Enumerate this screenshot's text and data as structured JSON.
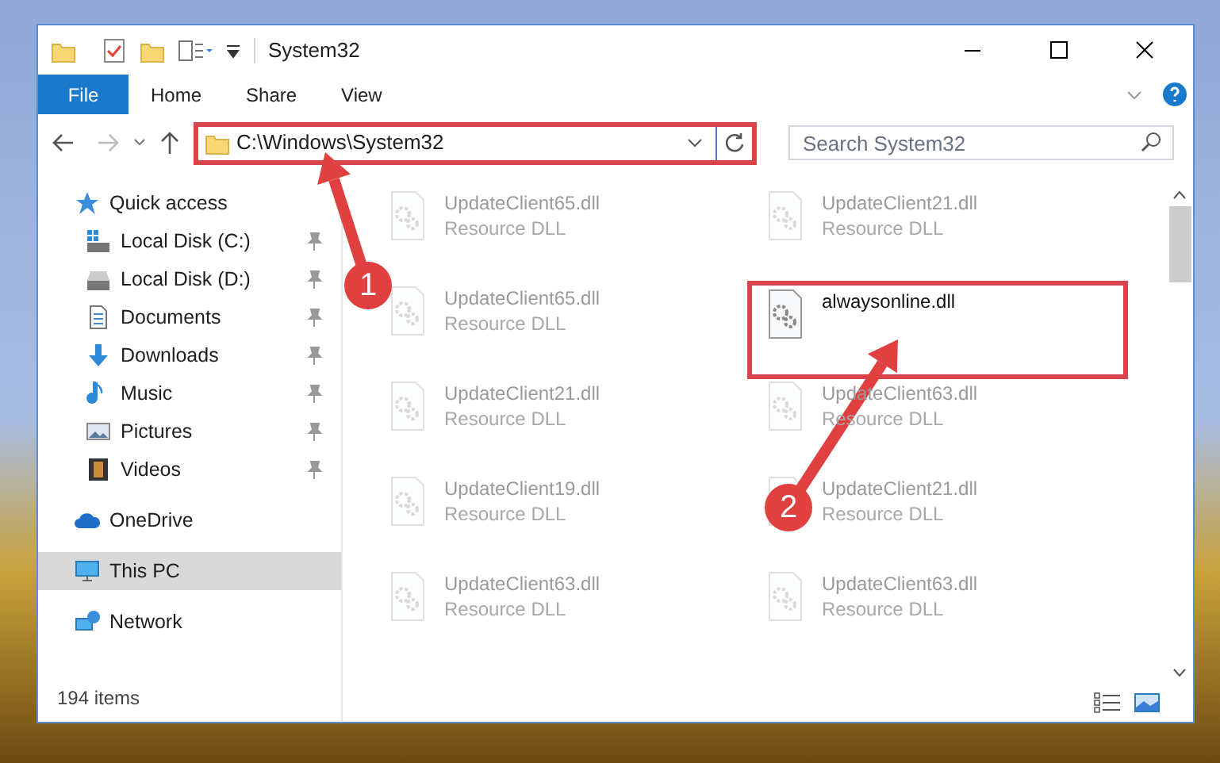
{
  "window": {
    "title": "System32"
  },
  "ribbon_tabs": [
    {
      "label": "File",
      "kind": "file"
    },
    {
      "label": "Home",
      "kind": "tab"
    },
    {
      "label": "Share",
      "kind": "tab"
    },
    {
      "label": "View",
      "kind": "tab"
    }
  ],
  "address_bar": {
    "path": "C:\\Windows\\System32",
    "highlighted": true
  },
  "search": {
    "placeholder": "Search System32"
  },
  "sidebar": {
    "items": [
      {
        "label": "Quick access",
        "selected": false,
        "children": [
          {
            "label": "Local Disk (C:)",
            "pinned": true
          },
          {
            "label": "Local Disk (D:)",
            "pinned": true
          },
          {
            "label": "Documents",
            "pinned": true
          },
          {
            "label": "Downloads",
            "pinned": true
          },
          {
            "label": "Music",
            "pinned": true
          },
          {
            "label": "Pictures",
            "pinned": true
          },
          {
            "label": "Videos",
            "pinned": true
          }
        ]
      },
      {
        "label": "OneDrive",
        "selected": false
      },
      {
        "label": "This PC",
        "selected": true
      },
      {
        "label": "Network",
        "selected": false
      }
    ]
  },
  "files": [
    {
      "name": "UpdateClient65.dll",
      "type": "Resource DLL",
      "faded": true,
      "highlighted": false
    },
    {
      "name": "UpdateClient21.dll",
      "type": "Resource DLL",
      "faded": true,
      "highlighted": false
    },
    {
      "name": "UpdateClient65.dll",
      "type": "Resource DLL",
      "faded": true,
      "highlighted": false
    },
    {
      "name": "alwaysonline.dll",
      "faded": false,
      "highlighted": true
    },
    {
      "name": "UpdateClient21.dll",
      "type": "Resource DLL",
      "faded": true,
      "highlighted": false
    },
    {
      "name": "UpdateClient63.dll",
      "type": "Resource DLL",
      "faded": true,
      "highlighted": false
    },
    {
      "name": "UpdateClient19.dll",
      "type": "Resource DLL",
      "faded": true,
      "highlighted": false
    },
    {
      "name": "UpdateClient21.dll",
      "type": "Resource DLL",
      "faded": true,
      "highlighted": false
    },
    {
      "name": "UpdateClient63.dll",
      "type": "Resource DLL",
      "faded": true,
      "highlighted": false
    },
    {
      "name": "UpdateClient63.dll",
      "type": "Resource DLL",
      "faded": true,
      "highlighted": false
    }
  ],
  "status_bar": {
    "item_count": "194 items"
  },
  "annotations": [
    {
      "label": "1"
    },
    {
      "label": "2"
    }
  ]
}
